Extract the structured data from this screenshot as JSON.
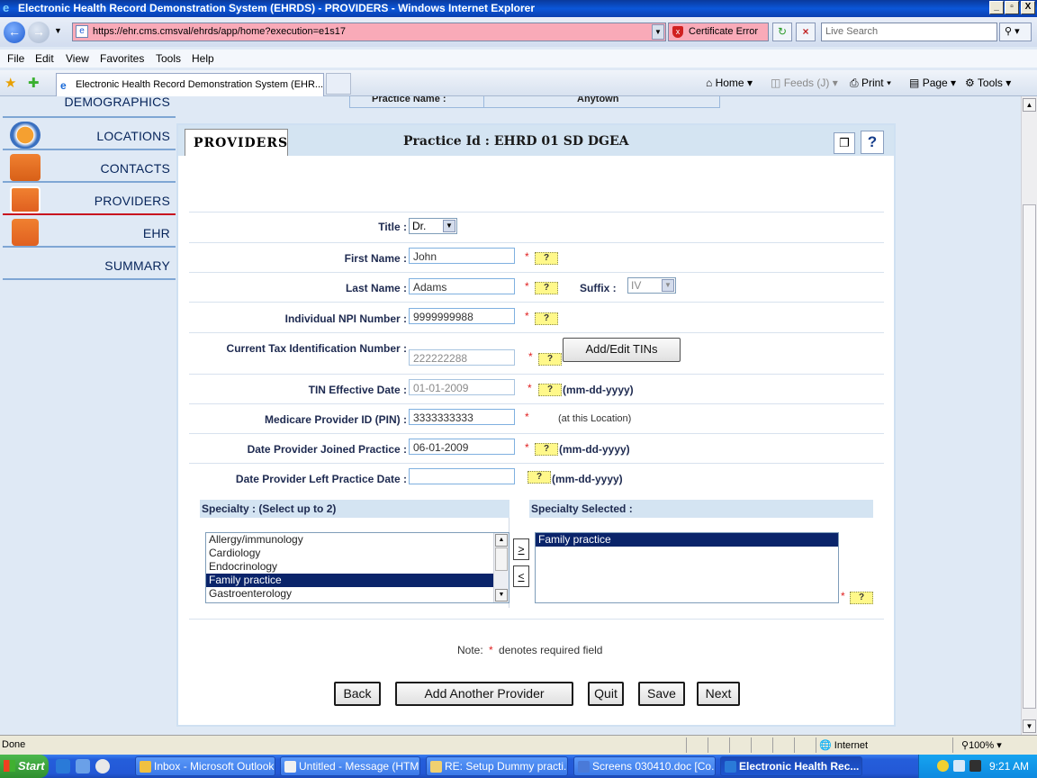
{
  "window": {
    "title": "Electronic Health Record Demonstration System (EHRDS) - PROVIDERS - Windows Internet Explorer",
    "minimize": "_",
    "maximize": "▫",
    "close": "X"
  },
  "addressbar": {
    "url": "https://ehr.cms.cmsval/ehrds/app/home?execution=e1s17",
    "cert_error": "Certificate Error",
    "search_placeholder": "Live Search"
  },
  "menu": [
    "File",
    "Edit",
    "View",
    "Favorites",
    "Tools",
    "Help"
  ],
  "tab": {
    "label": "Electronic Health Record Demonstration System (EHR..."
  },
  "commandbar": {
    "home": "Home",
    "feeds": "Feeds (J)",
    "print": "Print",
    "page": "Page",
    "tools": "Tools"
  },
  "practice_strip": {
    "name_label": "Practice Name :",
    "name_value": "Anytown"
  },
  "leftnav": [
    {
      "label": "DEMOGRAPHICS",
      "icon": "globe-icon"
    },
    {
      "label": "LOCATIONS",
      "icon": "globe-icon"
    },
    {
      "label": "CONTACTS",
      "icon": "people-icon"
    },
    {
      "label": "PROVIDERS",
      "icon": "ambulance-icon"
    },
    {
      "label": "EHR",
      "icon": "ehr-icon"
    },
    {
      "label": "SUMMARY",
      "icon": ""
    }
  ],
  "panel": {
    "tab_label": "PROVIDERS",
    "practice_id": "Practice Id : EHRD 01 SD DGEA"
  },
  "form": {
    "title_label": "Title :",
    "title_value": "Dr.",
    "first_name_label": "First Name :",
    "first_name_value": "John",
    "last_name_label": "Last Name :",
    "last_name_value": "Adams",
    "suffix_label": "Suffix :",
    "suffix_value": "IV",
    "npi_label": "Individual NPI Number :",
    "npi_value": "9999999988",
    "tin_label": "Current Tax Identification Number :",
    "tin_value": "222222288",
    "tin_button": "Add/Edit TINs",
    "tin_date_label": "TIN Effective Date :",
    "tin_date_value": "01-01-2009",
    "medicare_label": "Medicare Provider ID (PIN) :",
    "medicare_value": "3333333333",
    "medicare_note": "(at this Location)",
    "joined_label": "Date Provider Joined Practice :",
    "joined_value": "06-01-2009",
    "left_label": "Date Provider Left Practice Date :",
    "left_value": "",
    "date_format": "(mm-dd-yyyy)",
    "required_mark": "*",
    "help_mark": "?"
  },
  "specialty": {
    "available_header": "Specialty : (Select up to 2)",
    "selected_header": "Specialty Selected :",
    "available": [
      "Allergy/immunology",
      "Cardiology",
      "Endocrinology",
      "Family practice",
      "Gastroenterology"
    ],
    "selected_available_index": 3,
    "selected": [
      "Family practice"
    ],
    "add_btn": ">",
    "remove_btn": "<"
  },
  "note": {
    "prefix": "Note:",
    "star": "*",
    "text": "denotes required field"
  },
  "buttons": {
    "back": "Back",
    "add_another": "Add Another Provider",
    "quit": "Quit",
    "save": "Save",
    "next": "Next"
  },
  "statusbar": {
    "status": "Done",
    "zone": "Internet",
    "zoom": "100%"
  },
  "taskbar": {
    "start": "Start",
    "tasks": [
      "Inbox - Microsoft Outlook",
      "Untitled - Message (HTML)",
      "RE: Setup Dummy practi...",
      "Screens 030410.doc [Co...",
      "Electronic Health Rec..."
    ],
    "clock": "9:21 AM"
  }
}
